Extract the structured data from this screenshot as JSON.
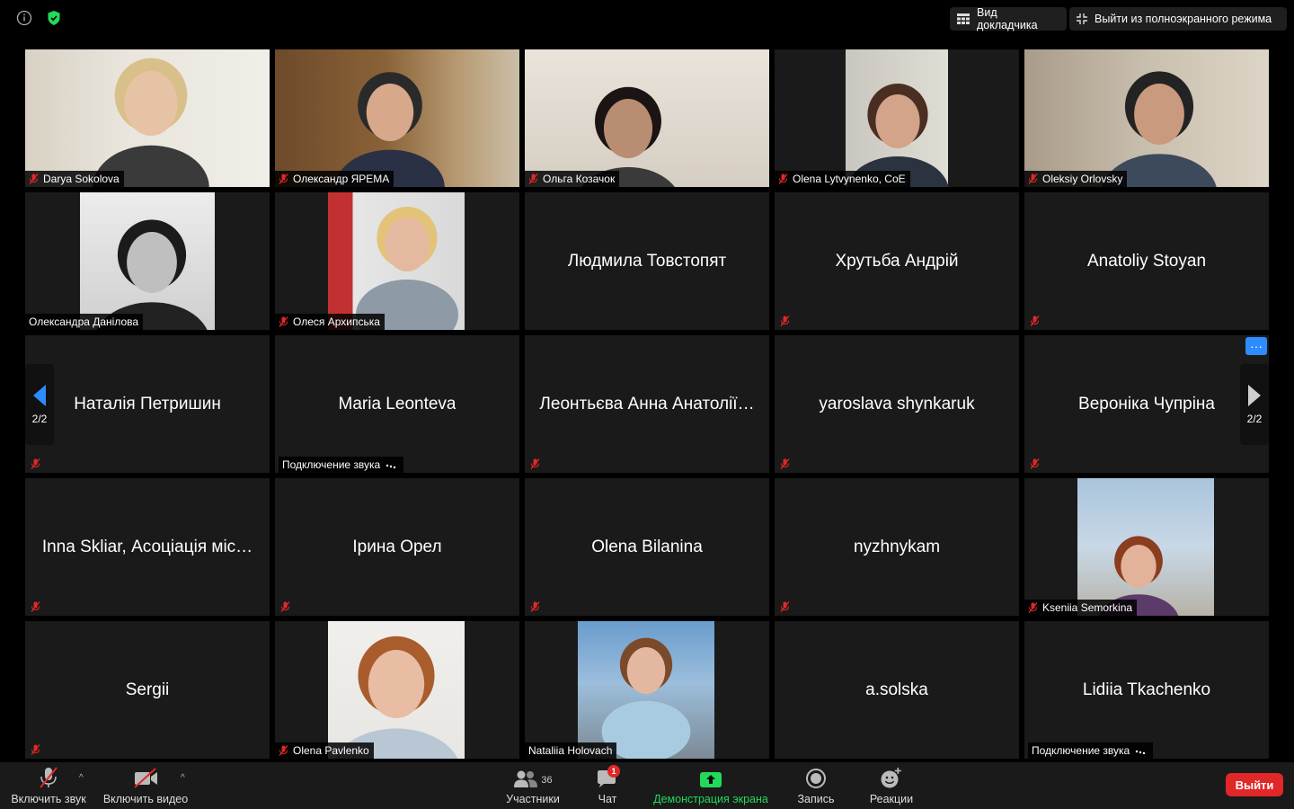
{
  "topbar": {
    "speaker_view_label": "Вид докладчика",
    "exit_fullscreen_label": "Выйти из полноэкранного режима"
  },
  "pager": {
    "left_label": "2/2",
    "right_label": "2/2"
  },
  "tiles": [
    {
      "name": "Darya Sokolova",
      "video": true,
      "muted": true
    },
    {
      "name": "Олександр ЯРЕМА",
      "video": true,
      "muted": true
    },
    {
      "name": "Ольга Козачок",
      "video": true,
      "muted": true
    },
    {
      "name": "Olena Lytvynenko, CoE",
      "video": true,
      "muted": true
    },
    {
      "name": "Oleksiy Orlovsky",
      "video": true,
      "muted": true
    },
    {
      "name": "Олександра Данілова",
      "video": true,
      "muted": false
    },
    {
      "name": "Олеся Архипська",
      "video": true,
      "muted": true
    },
    {
      "name": "Людмила Товстопят",
      "video": false,
      "muted": false
    },
    {
      "name": "Хрутьба Андрій",
      "video": false,
      "muted": true
    },
    {
      "name": "Anatoliy Stoyan",
      "video": false,
      "muted": true
    },
    {
      "name": "Наталія Петришин",
      "video": false,
      "muted": true
    },
    {
      "name": "Maria Leonteva",
      "video": false,
      "muted": false,
      "status": "Подключение звука"
    },
    {
      "name": "Леонтьєва Анна Анатолії…",
      "video": false,
      "muted": true
    },
    {
      "name": "yaroslava shynkaruk",
      "video": false,
      "muted": true
    },
    {
      "name": "Вероніка Чупріна",
      "video": false,
      "muted": true
    },
    {
      "name": "Inna Skliar,  Асоціація міс…",
      "video": false,
      "muted": true
    },
    {
      "name": "Ірина Орел",
      "video": false,
      "muted": true
    },
    {
      "name": "Olena Bilanina",
      "video": false,
      "muted": true
    },
    {
      "name": "nyzhnykam",
      "video": false,
      "muted": true
    },
    {
      "name": "Kseniia Semorkina",
      "video": true,
      "muted": true
    },
    {
      "name": "Sergii",
      "video": false,
      "muted": true
    },
    {
      "name": "Olena Pavlenko",
      "video": true,
      "muted": true
    },
    {
      "name": "Nataliia Holovach",
      "video": true,
      "muted": false
    },
    {
      "name": "a.solska",
      "video": false,
      "muted": false
    },
    {
      "name": "Lidiia Tkachenko",
      "video": false,
      "muted": false,
      "status": "Подключение звука"
    }
  ],
  "more_button_label": "···",
  "toolbar": {
    "unmute_label": "Включить звук",
    "start_video_label": "Включить видео",
    "participants_label": "Участники",
    "participants_count": "36",
    "chat_label": "Чат",
    "chat_badge": "1",
    "share_label": "Демонстрация экрана",
    "record_label": "Запись",
    "reactions_label": "Реакции",
    "leave_label": "Выйти"
  },
  "colors": {
    "accent_blue": "#2d8cff",
    "share_green": "#23d959",
    "leave_red": "#e02828",
    "muted_red": "#e02828",
    "shield_green": "#23d959"
  }
}
